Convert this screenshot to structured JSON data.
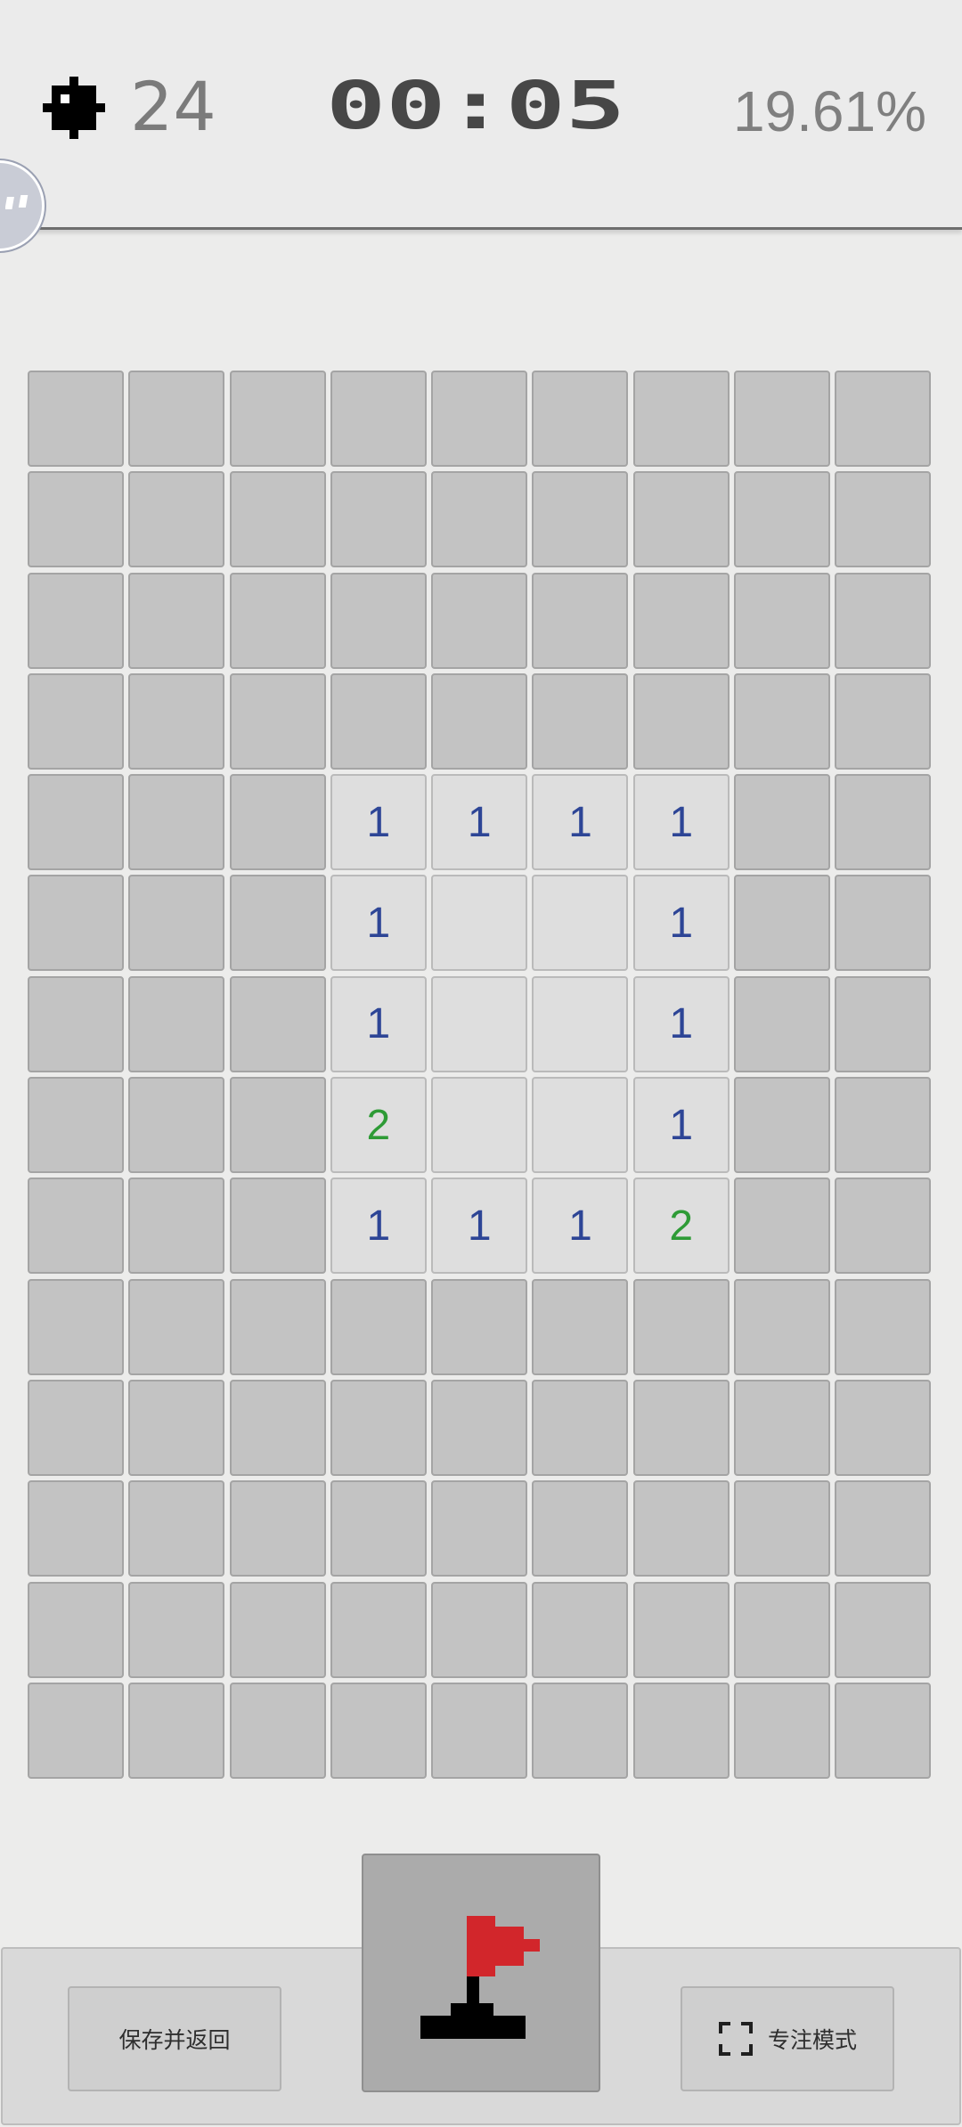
{
  "header": {
    "mines_remaining": "24",
    "timer": "00:05",
    "progress": "19.61%",
    "icon_mine": "mine-icon",
    "icon_float": "floating-assistant-icon"
  },
  "board": {
    "cols": 9,
    "rows": 14,
    "colors": {
      "closed": "#c3c3c3",
      "opened": "#dedede",
      "number_1": "#2d4596",
      "number_2": "#2e9b36"
    },
    "cells": [
      [
        "#",
        "#",
        "#",
        "#",
        "#",
        "#",
        "#",
        "#",
        "#"
      ],
      [
        "#",
        "#",
        "#",
        "#",
        "#",
        "#",
        "#",
        "#",
        "#"
      ],
      [
        "#",
        "#",
        "#",
        "#",
        "#",
        "#",
        "#",
        "#",
        "#"
      ],
      [
        "#",
        "#",
        "#",
        "#",
        "#",
        "#",
        "#",
        "#",
        "#"
      ],
      [
        "#",
        "#",
        "#",
        "1",
        "1",
        "1",
        "1",
        "#",
        "#"
      ],
      [
        "#",
        "#",
        "#",
        "1",
        "0",
        "0",
        "1",
        "#",
        "#"
      ],
      [
        "#",
        "#",
        "#",
        "1",
        "0",
        "0",
        "1",
        "#",
        "#"
      ],
      [
        "#",
        "#",
        "#",
        "2",
        "0",
        "0",
        "1",
        "#",
        "#"
      ],
      [
        "#",
        "#",
        "#",
        "1",
        "1",
        "1",
        "2",
        "#",
        "#"
      ],
      [
        "#",
        "#",
        "#",
        "#",
        "#",
        "#",
        "#",
        "#",
        "#"
      ],
      [
        "#",
        "#",
        "#",
        "#",
        "#",
        "#",
        "#",
        "#",
        "#"
      ],
      [
        "#",
        "#",
        "#",
        "#",
        "#",
        "#",
        "#",
        "#",
        "#"
      ],
      [
        "#",
        "#",
        "#",
        "#",
        "#",
        "#",
        "#",
        "#",
        "#"
      ],
      [
        "#",
        "#",
        "#",
        "#",
        "#",
        "#",
        "#",
        "#",
        "#"
      ]
    ]
  },
  "bottom": {
    "save_label": "保存并返回",
    "focus_label": "专注模式",
    "flag_icon": "flag-icon",
    "focus_icon": "fullscreen-icon"
  }
}
